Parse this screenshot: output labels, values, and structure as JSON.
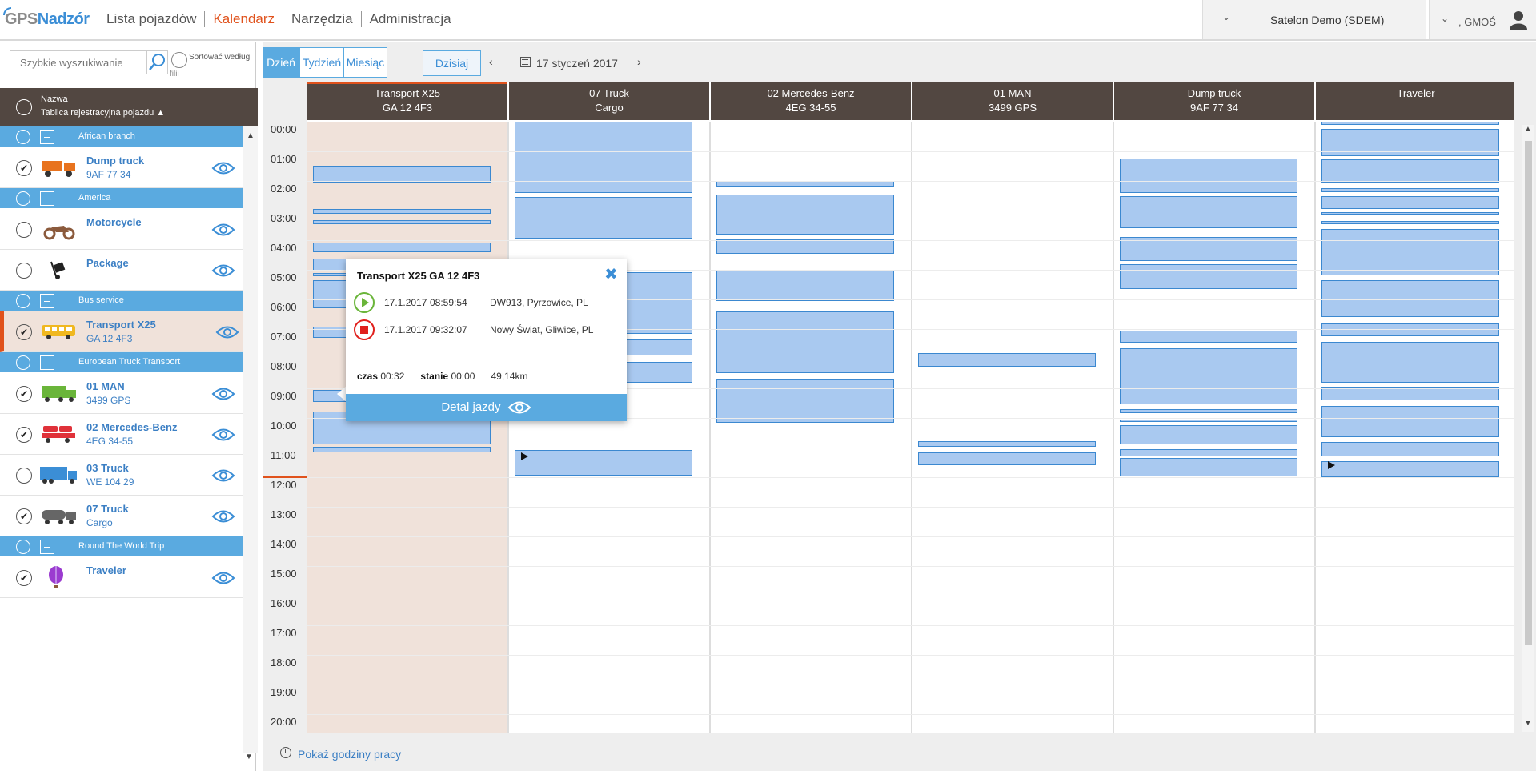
{
  "header": {
    "logo_gps": "GPS",
    "logo_nadzor": "Nadzór",
    "nav": [
      {
        "label": "Lista pojazdów",
        "active": false
      },
      {
        "label": "Kalendarz",
        "active": true
      },
      {
        "label": "Narzędzia",
        "active": false
      },
      {
        "label": "Administracja",
        "active": false
      }
    ],
    "company": "Satelon Demo (SDEM)",
    "user": ", GMOŚ"
  },
  "sidebar": {
    "search_placeholder": "Szybkie wyszukiwanie",
    "sort_label": "Sortować według",
    "sort_label2": "filii",
    "header_name": "Nazwa",
    "header_plate": "Tablica rejestracyjna pojazdu ▲",
    "groups": [
      {
        "name": "African branch",
        "vehicles": [
          {
            "name": "Dump truck",
            "plate": "9AF 77 34",
            "checked": true,
            "selected": false,
            "icon": "dump-truck-icon",
            "color": "#e8731e"
          }
        ]
      },
      {
        "name": "America",
        "vehicles": [
          {
            "name": "Motorcycle",
            "plate": "",
            "checked": false,
            "selected": false,
            "icon": "motorcycle-icon",
            "color": "#8b5a3c"
          },
          {
            "name": "Package",
            "plate": "",
            "checked": false,
            "selected": false,
            "icon": "package-trolley-icon",
            "color": "#222222"
          }
        ]
      },
      {
        "name": "Bus service",
        "vehicles": [
          {
            "name": "Transport X25",
            "plate": "GA 12 4F3",
            "checked": true,
            "selected": true,
            "icon": "bus-icon",
            "color": "#f0b820"
          }
        ]
      },
      {
        "name": "European Truck Transport",
        "vehicles": [
          {
            "name": "01 MAN",
            "plate": "3499 GPS",
            "checked": true,
            "selected": false,
            "icon": "truck-icon",
            "color": "#6ab53a"
          },
          {
            "name": "02 Mercedes-Benz",
            "plate": "4EG 34-55",
            "checked": true,
            "selected": false,
            "icon": "car-transporter-icon",
            "color": "#e0323a"
          },
          {
            "name": "03 Truck",
            "plate": "WE 104 29",
            "checked": false,
            "selected": false,
            "icon": "semi-truck-icon",
            "color": "#3b8ed6"
          },
          {
            "name": "07 Truck",
            "plate": "Cargo",
            "checked": true,
            "selected": false,
            "icon": "tanker-truck-icon",
            "color": "#666666"
          }
        ]
      },
      {
        "name": "Round The World Trip",
        "vehicles": [
          {
            "name": "Traveler",
            "plate": "",
            "checked": true,
            "selected": false,
            "icon": "hot-air-balloon-icon",
            "color": "#9b3bd0"
          }
        ]
      }
    ]
  },
  "calendar": {
    "views": [
      {
        "label": "Dzień",
        "active": true
      },
      {
        "label": "Tydzień",
        "active": false
      },
      {
        "label": "Miesiąc",
        "active": false
      }
    ],
    "today_label": "Dzisiaj",
    "date_label": "17 styczeń 2017",
    "hours": [
      "00:00",
      "01:00",
      "02:00",
      "03:00",
      "04:00",
      "05:00",
      "06:00",
      "07:00",
      "08:00",
      "09:00",
      "10:00",
      "11:00",
      "12:00",
      "13:00",
      "14:00",
      "15:00",
      "16:00",
      "17:00",
      "18:00",
      "19:00",
      "20:00"
    ],
    "columns": [
      {
        "line1": "Transport X25",
        "line2": "GA 12 4F3",
        "active": true,
        "events": [
          [
            1.48,
            2.05
          ],
          [
            2.95,
            3.1
          ],
          [
            3.33,
            3.45
          ],
          [
            4.07,
            4.4
          ],
          [
            4.62,
            5.05
          ],
          [
            5.12,
            5.22
          ],
          [
            5.35,
            6.3
          ],
          [
            6.92,
            7.3
          ],
          [
            9.05,
            9.45
          ],
          [
            9.78,
            10.9
          ],
          [
            10.98,
            11.15
          ]
        ],
        "running_at": null
      },
      {
        "line1": "07 Truck",
        "line2": "Cargo",
        "active": false,
        "events": [
          [
            0,
            2.4
          ],
          [
            2.55,
            3.95
          ],
          [
            5.07,
            7.15
          ],
          [
            7.35,
            7.9
          ],
          [
            8.1,
            8.8
          ],
          [
            11.08,
            11.95
          ]
        ],
        "running_at": 11.3
      },
      {
        "line1": "02 Mercedes-Benz",
        "line2": "4EG 34-55",
        "active": false,
        "events": [
          [
            2.0,
            2.2
          ],
          [
            2.45,
            3.8
          ],
          [
            3.97,
            4.45
          ],
          [
            5.0,
            6.05
          ],
          [
            6.4,
            8.5
          ],
          [
            8.7,
            10.15
          ]
        ],
        "running_at": null
      },
      {
        "line1": "01 MAN",
        "line2": "3499 GPS",
        "active": false,
        "events": [
          [
            7.8,
            8.28
          ],
          [
            10.78,
            10.98
          ],
          [
            11.15,
            11.6
          ]
        ],
        "running_at": null
      },
      {
        "line1": "Dump truck",
        "line2": "9AF 77 34",
        "active": false,
        "events": [
          [
            1.25,
            2.4
          ],
          [
            2.5,
            3.6
          ],
          [
            3.9,
            4.7
          ],
          [
            4.8,
            5.65
          ],
          [
            7.05,
            7.45
          ],
          [
            7.65,
            9.55
          ],
          [
            9.7,
            9.85
          ],
          [
            10.05,
            10.12
          ],
          [
            10.25,
            10.88
          ],
          [
            11.05,
            11.3
          ],
          [
            11.35,
            11.98
          ]
        ],
        "running_at": null
      },
      {
        "line1": "Traveler",
        "line2": "",
        "active": false,
        "events": [
          [
            0,
            0.1
          ],
          [
            0.25,
            1.15
          ],
          [
            1.27,
            2.05
          ],
          [
            2.25,
            2.38
          ],
          [
            2.5,
            2.95
          ],
          [
            3.05,
            3.1
          ],
          [
            3.35,
            3.45
          ],
          [
            3.62,
            5.2
          ],
          [
            5.35,
            6.6
          ],
          [
            6.82,
            7.25
          ],
          [
            7.42,
            8.8
          ],
          [
            8.95,
            9.4
          ],
          [
            9.6,
            10.65
          ],
          [
            10.8,
            11.3
          ],
          [
            11.45,
            12.0
          ]
        ],
        "running_at": 11.6
      }
    ]
  },
  "popup": {
    "title": "Transport X25 GA 12 4F3",
    "start": {
      "date": "17.1.2017",
      "time": "08:59:54",
      "location": "DW913, Pyrzowice, PL"
    },
    "stop": {
      "date": "17.1.2017",
      "time": "09:32:07",
      "location": "Nowy Świat, Gliwice, PL"
    },
    "czas_label": "czas",
    "czas_value": "00:32",
    "stanie_label": "stanie",
    "stanie_value": "00:00",
    "distance": "49,14km",
    "button_label": "Detal jazdy"
  },
  "footer": {
    "label": "Pokaż godziny pracy"
  },
  "colors": {
    "accent": "#e0521c",
    "primary": "#5aaae0",
    "header_dark": "#524741",
    "event_fill": "#a9c9f0",
    "event_border": "#3b88d0"
  }
}
